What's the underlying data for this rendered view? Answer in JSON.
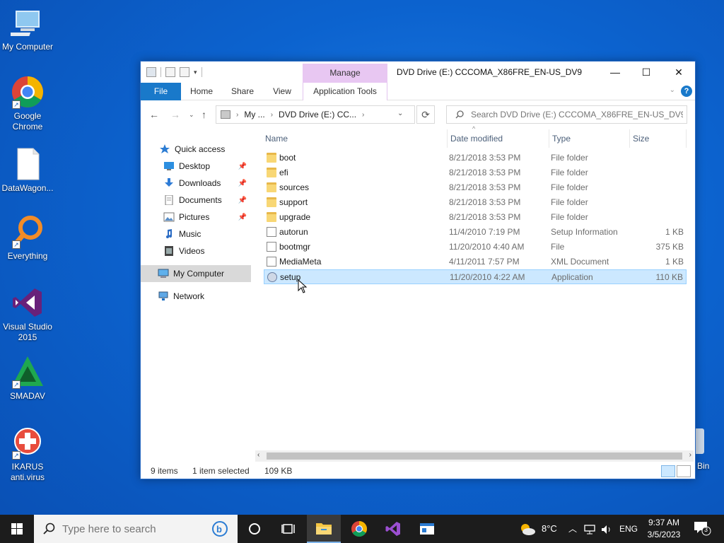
{
  "desktop": {
    "icons": [
      {
        "label": "My Computer"
      },
      {
        "label": "Google Chrome"
      },
      {
        "label": "DataWagon..."
      },
      {
        "label": "Everything"
      },
      {
        "label": "Visual Studio 2015"
      },
      {
        "label": "SMADAV"
      },
      {
        "label": "IKARUS anti.virus"
      }
    ],
    "recycle_partial_label": "Bin"
  },
  "window": {
    "title": "DVD Drive (E:) CCCOMA_X86FRE_EN-US_DV9",
    "contextual_tab": "Manage",
    "tabs": [
      "File",
      "Home",
      "Share",
      "View",
      "Application Tools"
    ],
    "address": {
      "segments": [
        "My ...",
        "DVD Drive (E:) CC..."
      ]
    },
    "search_placeholder": "Search DVD Drive (E:) CCCOMA_X86FRE_EN-US_DV9",
    "nav": [
      {
        "label": "Quick access",
        "icon": "star-icon"
      },
      {
        "label": "Desktop",
        "icon": "desktop-icon",
        "pinned": true
      },
      {
        "label": "Downloads",
        "icon": "download-icon",
        "pinned": true
      },
      {
        "label": "Documents",
        "icon": "documents-icon",
        "pinned": true
      },
      {
        "label": "Pictures",
        "icon": "pictures-icon",
        "pinned": true
      },
      {
        "label": "Music",
        "icon": "music-icon"
      },
      {
        "label": "Videos",
        "icon": "videos-icon"
      },
      {
        "label": "My Computer",
        "icon": "computer-icon",
        "selected": true
      },
      {
        "label": "Network",
        "icon": "network-icon"
      }
    ],
    "columns": [
      "Name",
      "Date modified",
      "Type",
      "Size"
    ],
    "files": [
      {
        "name": "boot",
        "date": "8/21/2018 3:53 PM",
        "type": "File folder",
        "size": "",
        "kind": "folder"
      },
      {
        "name": "efi",
        "date": "8/21/2018 3:53 PM",
        "type": "File folder",
        "size": "",
        "kind": "folder"
      },
      {
        "name": "sources",
        "date": "8/21/2018 3:53 PM",
        "type": "File folder",
        "size": "",
        "kind": "folder"
      },
      {
        "name": "support",
        "date": "8/21/2018 3:53 PM",
        "type": "File folder",
        "size": "",
        "kind": "folder"
      },
      {
        "name": "upgrade",
        "date": "8/21/2018 3:53 PM",
        "type": "File folder",
        "size": "",
        "kind": "folder"
      },
      {
        "name": "autorun",
        "date": "11/4/2010 7:19 PM",
        "type": "Setup Information",
        "size": "1 KB",
        "kind": "file"
      },
      {
        "name": "bootmgr",
        "date": "11/20/2010 4:40 AM",
        "type": "File",
        "size": "375 KB",
        "kind": "file"
      },
      {
        "name": "MediaMeta",
        "date": "4/11/2011 7:57 PM",
        "type": "XML Document",
        "size": "1 KB",
        "kind": "file"
      },
      {
        "name": "setup",
        "date": "11/20/2010 4:22 AM",
        "type": "Application",
        "size": "110 KB",
        "kind": "setup",
        "selected": true
      }
    ],
    "status": {
      "items": "9 items",
      "selected": "1 item selected",
      "size": "109 KB"
    }
  },
  "taskbar": {
    "search_placeholder": "Type here to search",
    "weather": "8°C",
    "language": "ENG",
    "time": "9:37 AM",
    "date": "3/5/2023",
    "notifications": "3"
  },
  "colors": {
    "accent": "#1979ca",
    "selection": "#cce8ff",
    "manage_tab": "#e8c7f2"
  }
}
